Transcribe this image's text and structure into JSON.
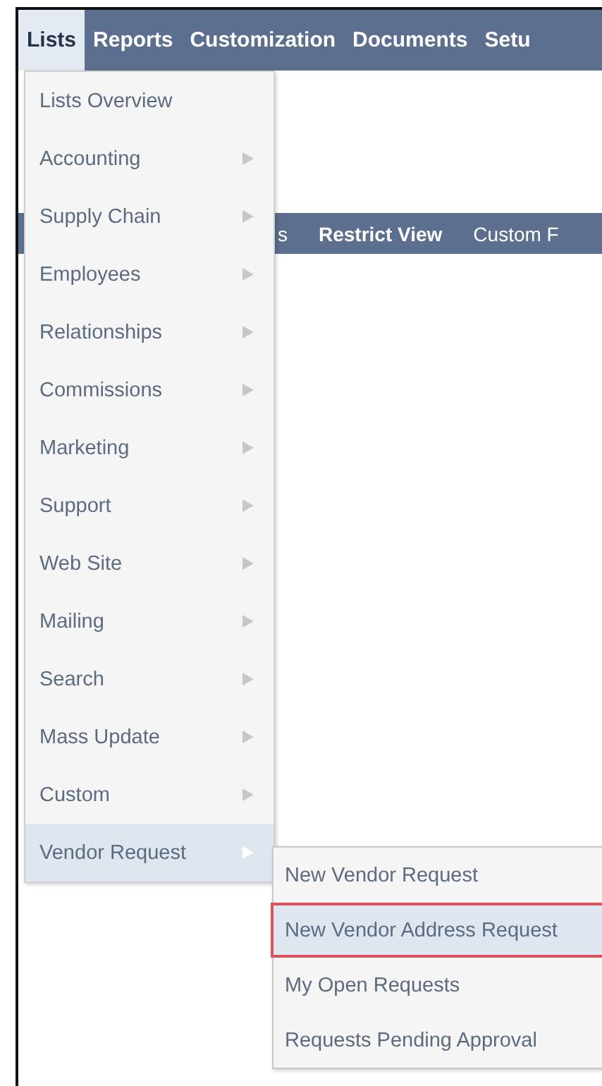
{
  "nav_tabs": [
    {
      "label": "Lists",
      "selected": true
    },
    {
      "label": "Reports",
      "selected": false
    },
    {
      "label": "Customization",
      "selected": false
    },
    {
      "label": "Documents",
      "selected": false
    },
    {
      "label": "Setu",
      "selected": false
    }
  ],
  "sub_bar": [
    {
      "label": "s",
      "bold": false
    },
    {
      "label": "Restrict View",
      "bold": true
    },
    {
      "label": "Custom F",
      "bold": false
    }
  ],
  "menu": [
    {
      "label": "Lists Overview",
      "submenu": false,
      "selected": false
    },
    {
      "label": "Accounting",
      "submenu": true,
      "selected": false
    },
    {
      "label": "Supply Chain",
      "submenu": true,
      "selected": false
    },
    {
      "label": "Employees",
      "submenu": true,
      "selected": false
    },
    {
      "label": "Relationships",
      "submenu": true,
      "selected": false
    },
    {
      "label": "Commissions",
      "submenu": true,
      "selected": false
    },
    {
      "label": "Marketing",
      "submenu": true,
      "selected": false
    },
    {
      "label": "Support",
      "submenu": true,
      "selected": false
    },
    {
      "label": "Web Site",
      "submenu": true,
      "selected": false
    },
    {
      "label": "Mailing",
      "submenu": true,
      "selected": false
    },
    {
      "label": "Search",
      "submenu": true,
      "selected": false
    },
    {
      "label": "Mass Update",
      "submenu": true,
      "selected": false
    },
    {
      "label": "Custom",
      "submenu": true,
      "selected": false
    },
    {
      "label": "Vendor Request",
      "submenu": true,
      "selected": true
    }
  ],
  "submenu": [
    {
      "label": "New Vendor Request",
      "selected": false
    },
    {
      "label": "New Vendor Address Request",
      "selected": true
    },
    {
      "label": "My Open Requests",
      "selected": false
    },
    {
      "label": "Requests Pending Approval",
      "selected": false
    }
  ]
}
